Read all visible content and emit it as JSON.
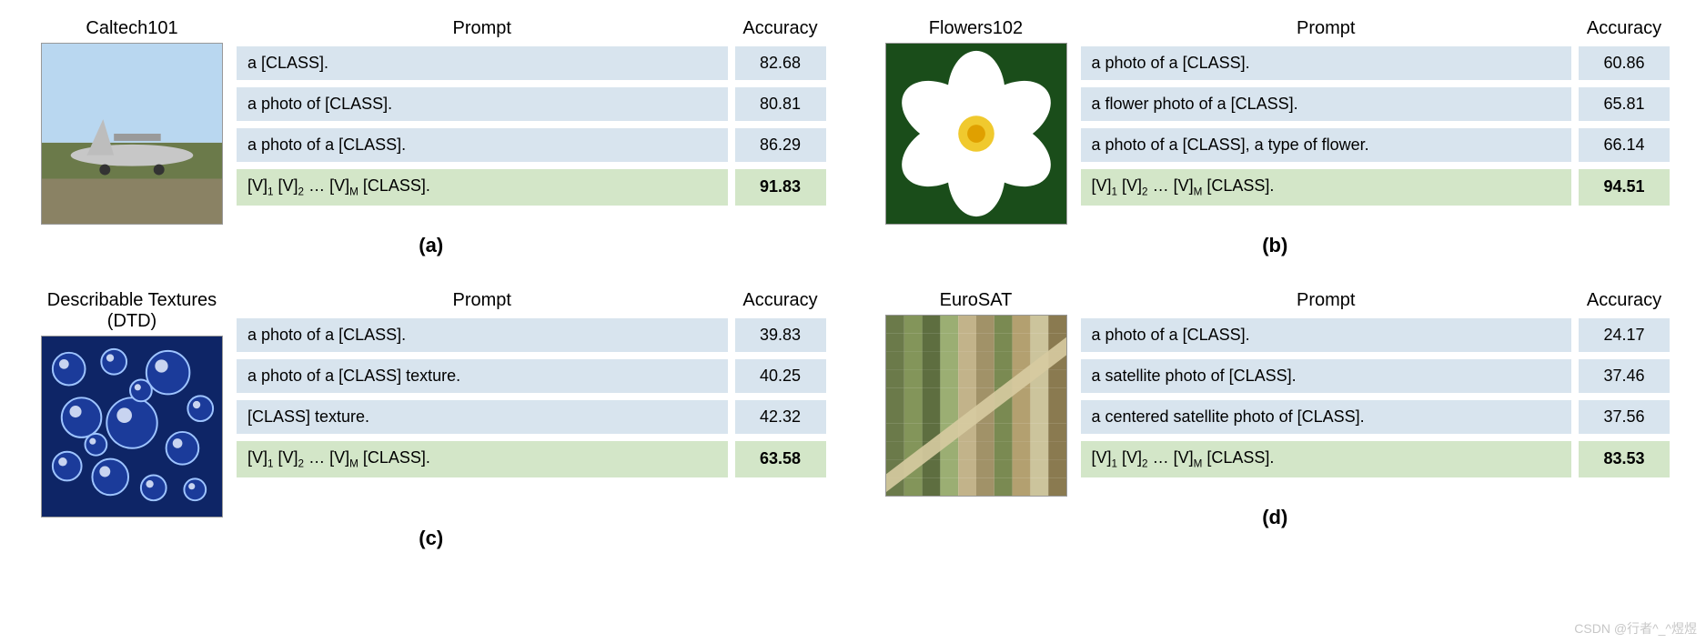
{
  "headers": {
    "prompt": "Prompt",
    "accuracy": "Accuracy"
  },
  "learned_prompt_html": "[V]<sub>1</sub> [V]<sub>2</sub> … [V]<sub>M</sub> [CLASS].",
  "panels": [
    {
      "label": "(a)",
      "dataset": "Caltech101",
      "image": "airplane",
      "rows": [
        {
          "prompt": "a [CLASS].",
          "acc": "82.68",
          "learned": false
        },
        {
          "prompt": "a photo of [CLASS].",
          "acc": "80.81",
          "learned": false
        },
        {
          "prompt": "a photo of a [CLASS].",
          "acc": "86.29",
          "learned": false
        },
        {
          "prompt": "__LEARNED__",
          "acc": "91.83",
          "learned": true
        }
      ]
    },
    {
      "label": "(b)",
      "dataset": "Flowers102",
      "image": "flower",
      "rows": [
        {
          "prompt": "a photo of a [CLASS].",
          "acc": "60.86",
          "learned": false
        },
        {
          "prompt": "a flower photo of a [CLASS].",
          "acc": "65.81",
          "learned": false
        },
        {
          "prompt": "a photo of a [CLASS], a type of flower.",
          "acc": "66.14",
          "learned": false
        },
        {
          "prompt": "__LEARNED__",
          "acc": "94.51",
          "learned": true
        }
      ]
    },
    {
      "label": "(c)",
      "dataset": "Describable Textures (DTD)",
      "image": "bubbles",
      "rows": [
        {
          "prompt": "a photo of a [CLASS].",
          "acc": "39.83",
          "learned": false
        },
        {
          "prompt": "a photo of a [CLASS] texture.",
          "acc": "40.25",
          "learned": false
        },
        {
          "prompt": "[CLASS] texture.",
          "acc": "42.32",
          "learned": false
        },
        {
          "prompt": "__LEARNED__",
          "acc": "63.58",
          "learned": true
        }
      ]
    },
    {
      "label": "(d)",
      "dataset": "EuroSAT",
      "image": "satellite",
      "rows": [
        {
          "prompt": "a photo of a [CLASS].",
          "acc": "24.17",
          "learned": false
        },
        {
          "prompt": "a satellite photo of [CLASS].",
          "acc": "37.46",
          "learned": false
        },
        {
          "prompt": "a centered satellite photo of [CLASS].",
          "acc": "37.56",
          "learned": false
        },
        {
          "prompt": "__LEARNED__",
          "acc": "83.53",
          "learned": true
        }
      ]
    }
  ],
  "watermark": "CSDN @行者^_^煜煜",
  "chart_data": {
    "type": "table",
    "title": "Prompt engineering vs learned prompt accuracy across datasets",
    "series": [
      {
        "name": "Caltech101",
        "prompts": [
          "a [CLASS].",
          "a photo of [CLASS].",
          "a photo of a [CLASS].",
          "[V]1 [V]2 … [V]M [CLASS]."
        ],
        "accuracy": [
          82.68,
          80.81,
          86.29,
          91.83
        ]
      },
      {
        "name": "Flowers102",
        "prompts": [
          "a photo of a [CLASS].",
          "a flower photo of a [CLASS].",
          "a photo of a [CLASS], a type of flower.",
          "[V]1 [V]2 … [V]M [CLASS]."
        ],
        "accuracy": [
          60.86,
          65.81,
          66.14,
          94.51
        ]
      },
      {
        "name": "Describable Textures (DTD)",
        "prompts": [
          "a photo of a [CLASS].",
          "a photo of a [CLASS] texture.",
          "[CLASS] texture.",
          "[V]1 [V]2 … [V]M [CLASS]."
        ],
        "accuracy": [
          39.83,
          40.25,
          42.32,
          63.58
        ]
      },
      {
        "name": "EuroSAT",
        "prompts": [
          "a photo of a [CLASS].",
          "a satellite photo of [CLASS].",
          "a centered satellite photo of [CLASS].",
          "[V]1 [V]2 … [V]M [CLASS]."
        ],
        "accuracy": [
          24.17,
          37.46,
          37.56,
          83.53
        ]
      }
    ]
  }
}
